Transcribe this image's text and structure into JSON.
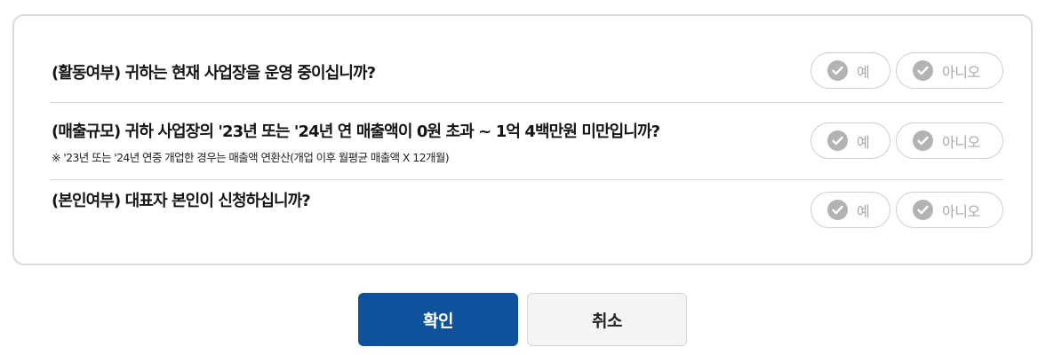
{
  "questions": [
    {
      "text": "(활동여부) 귀하는 현재 사업장을 운영 중이십니까?",
      "yes_label": "예",
      "no_label": "아니오"
    },
    {
      "text": "(매출규모) 귀하 사업장의 '23년 또는 '24년 연 매출액이 0원 초과 ~ 1억 4백만원 미만입니까?",
      "note": "※ '23년 또는 '24년 연중 개업한 경우는 매출액 연환산(개업 이후 월평균 매출액 X 12개월)",
      "yes_label": "예",
      "no_label": "아니오"
    },
    {
      "text": "(본인여부) 대표자 본인이 신청하십니까?",
      "yes_label": "예",
      "no_label": "아니오"
    }
  ],
  "actions": {
    "confirm_label": "확인",
    "cancel_label": "취소"
  },
  "icons": {
    "option_icon": "check-circle-icon"
  },
  "colors": {
    "primary": "#0f529c",
    "option_inactive": "#b3b3b3"
  }
}
